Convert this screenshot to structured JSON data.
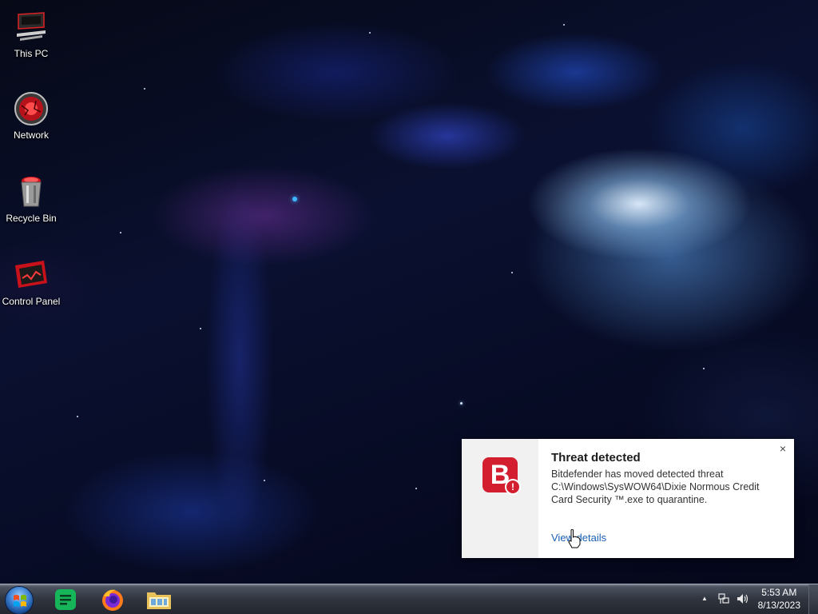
{
  "desktop": {
    "icons": [
      {
        "label": "This PC"
      },
      {
        "label": "Network"
      },
      {
        "label": "Recycle Bin"
      },
      {
        "label": "Control Panel"
      }
    ]
  },
  "toast": {
    "app_icon": "bitdefender-logo-icon",
    "logo_letter": "B",
    "badge": "!",
    "title": "Threat detected",
    "message": "Bitdefender has moved detected threat C:\\Windows\\SysWOW64\\Dixie Normous Credit Card Security ™.exe to quarantine.",
    "link": "View details",
    "close": "×",
    "accent": "#d31e2f",
    "link_color": "#1a5fb4"
  },
  "taskbar": {
    "start": "windows-start-orb",
    "apps": [
      "spreadsheet-app-icon",
      "firefox-icon",
      "file-explorer-icon"
    ],
    "tray": {
      "overflow": "▲",
      "icons": [
        "network-icon",
        "volume-icon"
      ]
    },
    "clock": {
      "time": "5:53 AM",
      "date": "8/13/2023"
    }
  }
}
